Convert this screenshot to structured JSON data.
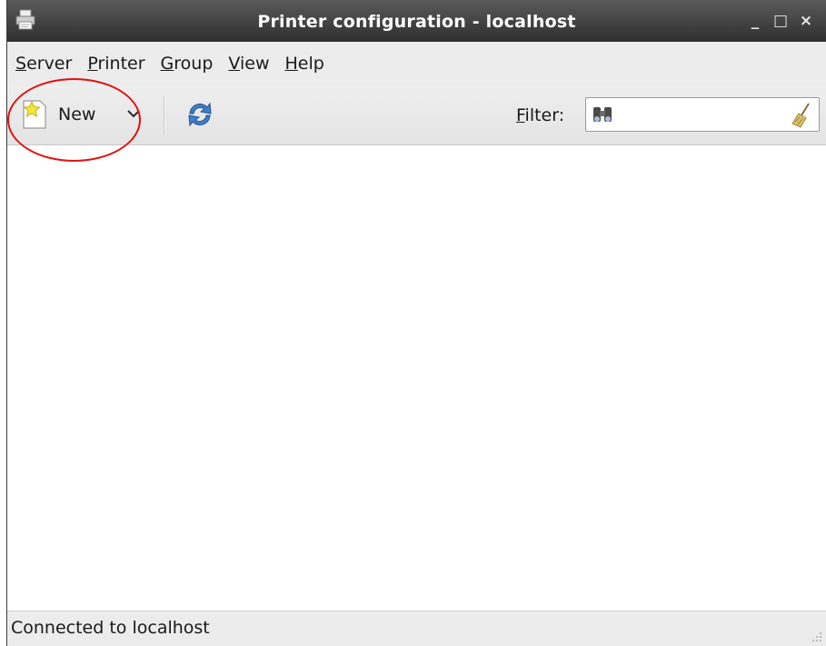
{
  "window": {
    "title": "Printer configuration - localhost",
    "controls": {
      "minimize": "_",
      "maximize": "□",
      "close": "×"
    }
  },
  "menubar": [
    {
      "mnemonic": "S",
      "rest": "erver"
    },
    {
      "mnemonic": "P",
      "rest": "rinter"
    },
    {
      "mnemonic": "G",
      "rest": "roup"
    },
    {
      "mnemonic": "V",
      "rest": "iew"
    },
    {
      "mnemonic": "H",
      "rest": "elp"
    }
  ],
  "toolbar": {
    "new_label": "New",
    "filter_mnemonic": "F",
    "filter_rest": "ilter:",
    "filter_value": "",
    "icons": [
      "printer-icon",
      "new-star-icon",
      "chevron-down-icon",
      "refresh-icon",
      "binoculars-icon",
      "broom-clear-icon"
    ]
  },
  "statusbar": {
    "text": "Connected to localhost"
  },
  "colors": {
    "annotation": "#e01010",
    "titlebar": "#3a3a3a",
    "chrome": "#ececec"
  }
}
